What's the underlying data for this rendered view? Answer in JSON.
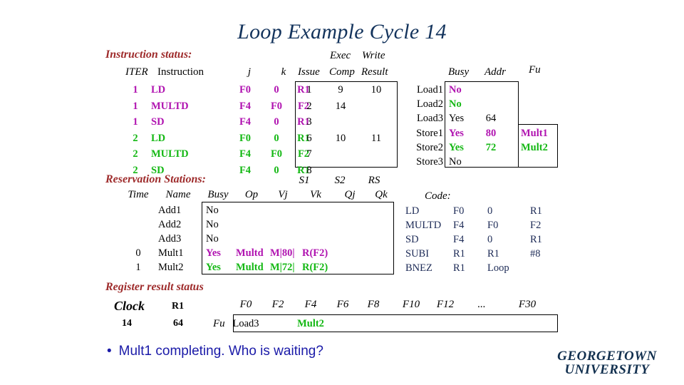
{
  "slide": {
    "title": "Loop Example Cycle 14",
    "bullet": {
      "marker": "•",
      "text": "Mult1 completing.  Who is waiting?"
    },
    "logo": {
      "line1": "GEORGETOWN",
      "line2": "UNIVERSITY"
    },
    "colors": {
      "title": "#13335c",
      "heading": "#9e2b2b",
      "iter1": "#b013b0",
      "iter2": "#14b814",
      "bullet": "#1a1aa8",
      "logo": "#12304f"
    }
  },
  "instruction_status": {
    "heading": "Instruction status:",
    "group_header": {
      "exec": "Exec",
      "write": "Write"
    },
    "headers": {
      "iter": "ITER",
      "instruction": "Instruction",
      "j": "j",
      "k": "k",
      "issue": "Issue",
      "comp": "Comp",
      "result": "Result"
    },
    "rows": [
      {
        "iter": "1",
        "instruction": "LD",
        "j": "F0",
        "k": "0",
        "dest": "R1",
        "issue": "1",
        "comp": "9",
        "result": "10",
        "color": "magenta"
      },
      {
        "iter": "1",
        "instruction": "MULTD",
        "j": "F4",
        "k": "F0",
        "dest": "F2",
        "issue": "2",
        "comp": "14",
        "result": "",
        "color": "magenta"
      },
      {
        "iter": "1",
        "instruction": "SD",
        "j": "F4",
        "k": "0",
        "dest": "R1",
        "issue": "3",
        "comp": "",
        "result": "",
        "color": "magenta"
      },
      {
        "iter": "2",
        "instruction": "LD",
        "j": "F0",
        "k": "0",
        "dest": "R1",
        "issue": "6",
        "comp": "10",
        "result": "11",
        "color": "green"
      },
      {
        "iter": "2",
        "instruction": "MULTD",
        "j": "F4",
        "k": "F0",
        "dest": "F2",
        "issue": "7",
        "comp": "",
        "result": "",
        "color": "green"
      },
      {
        "iter": "2",
        "instruction": "SD",
        "j": "F4",
        "k": "0",
        "dest": "R1",
        "issue": "8",
        "comp": "",
        "result": "",
        "color": "green"
      }
    ]
  },
  "load_store_units": {
    "headers": {
      "busy": "Busy",
      "addr": "Addr",
      "fu": "Fu"
    },
    "rows": [
      {
        "name": "Load1",
        "busy": "No",
        "addr": "",
        "fu": "",
        "color": "magenta"
      },
      {
        "name": "Load2",
        "busy": "No",
        "addr": "",
        "fu": "",
        "color": "green"
      },
      {
        "name": "Load3",
        "busy": "Yes",
        "addr": "64",
        "fu": "",
        "color": "black"
      },
      {
        "name": "Store1",
        "busy": "Yes",
        "addr": "80",
        "fu": "Mult1",
        "color": "magenta"
      },
      {
        "name": "Store2",
        "busy": "Yes",
        "addr": "72",
        "fu": "Mult2",
        "color": "green"
      },
      {
        "name": "Store3",
        "busy": "No",
        "addr": "",
        "fu": "",
        "color": "black"
      }
    ]
  },
  "reservation_stations": {
    "heading": "Reservation Stations:",
    "group_header": {
      "s1": "S1",
      "s2": "S2",
      "rs": "RS"
    },
    "headers": {
      "time": "Time",
      "name": "Name",
      "busy": "Busy",
      "op": "Op",
      "vj": "Vj",
      "vk": "Vk",
      "qj": "Qj",
      "qk": "Qk"
    },
    "rows": [
      {
        "time": "",
        "name": "Add1",
        "busy": "No",
        "op": "",
        "vj": "",
        "vk": "",
        "qj": "",
        "qk": "",
        "color": "black"
      },
      {
        "time": "",
        "name": "Add2",
        "busy": "No",
        "op": "",
        "vj": "",
        "vk": "",
        "qj": "",
        "qk": "",
        "color": "black"
      },
      {
        "time": "",
        "name": "Add3",
        "busy": "No",
        "op": "",
        "vj": "",
        "vk": "",
        "qj": "",
        "qk": "",
        "color": "black"
      },
      {
        "time": "0",
        "name": "Mult1",
        "busy": "Yes",
        "op": "Multd",
        "vj": "M|80|",
        "vk": "R(F2)",
        "qj": "",
        "qk": "",
        "color": "magenta"
      },
      {
        "time": "1",
        "name": "Mult2",
        "busy": "Yes",
        "op": "Multd",
        "vj": "M|72|",
        "vk": "R(F2)",
        "qj": "",
        "qk": "",
        "color": "green"
      }
    ]
  },
  "code": {
    "heading": "Code:",
    "rows": [
      {
        "op": "LD",
        "a": "F0",
        "b": "0",
        "c": "R1"
      },
      {
        "op": "MULTD",
        "a": "F4",
        "b": "F0",
        "c": "F2"
      },
      {
        "op": "SD",
        "a": "F4",
        "b": "0",
        "c": "R1"
      },
      {
        "op": "SUBI",
        "a": "R1",
        "b": "R1",
        "c": "#8"
      },
      {
        "op": "BNEZ",
        "a": "R1",
        "b": "Loop",
        "c": ""
      }
    ]
  },
  "register_result_status": {
    "heading": "Register result status",
    "clock_label": "Clock",
    "r1_label": "R1",
    "fu_label": "Fu",
    "clock_value": "14",
    "r1_value": "64",
    "registers": [
      "F0",
      "F2",
      "F4",
      "F6",
      "F8",
      "F10",
      "F12",
      "...",
      "F30"
    ],
    "values": [
      {
        "reg": "F0",
        "value": "Load3",
        "color": "black"
      },
      {
        "reg": "F2",
        "value": "",
        "color": "black"
      },
      {
        "reg": "F4",
        "value": "Mult2",
        "color": "green"
      },
      {
        "reg": "F6",
        "value": "",
        "color": "black"
      },
      {
        "reg": "F8",
        "value": "",
        "color": "black"
      },
      {
        "reg": "F10",
        "value": "",
        "color": "black"
      },
      {
        "reg": "F12",
        "value": "",
        "color": "black"
      },
      {
        "reg": "...",
        "value": "",
        "color": "black"
      },
      {
        "reg": "F30",
        "value": "",
        "color": "black"
      }
    ]
  }
}
